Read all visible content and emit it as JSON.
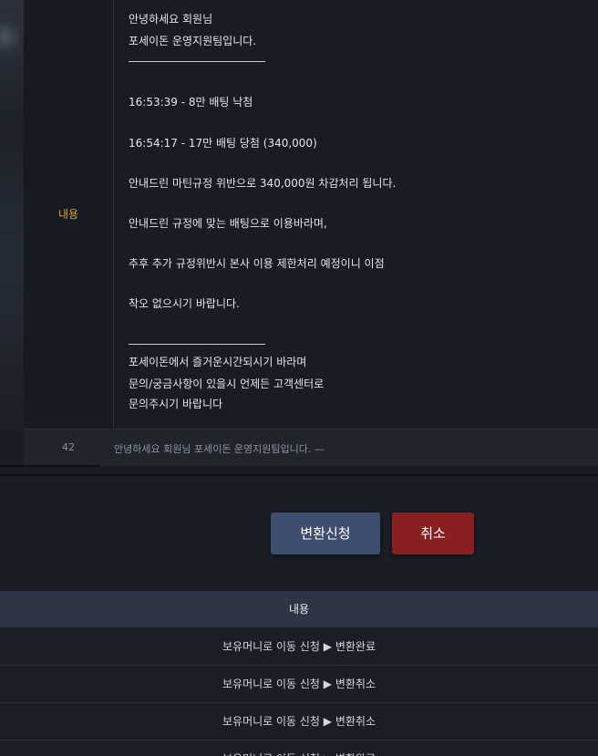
{
  "message": {
    "label": "내용",
    "lines": [
      "안녕하세요 회원님",
      "포세이돈 운영지원팀입니다.",
      "16:53:39 - 8만 배팅 낙첨",
      "16:54:17 - 17만 배팅 당첨 (340,000)",
      "안내드린 마틴규정 위반으로 340,000원 차감처리 됩니다.",
      "안내드린 규정에 맞는 배팅으로 이용바라며,",
      "추후 추가 규정위반시 본사 이용 제한처리 예정이니 이점",
      "착오 없으시기 바랍니다.",
      "포세이돈에서 즐거운시간되시기 바라며",
      "문의/궁금사항이 있을시 언제든 고객센터로",
      "문의주시기 바랍니다"
    ]
  },
  "row42": {
    "number": "42",
    "summary": "안녕하세요 회원님 포세이돈 운영지원팀입니다. —"
  },
  "buttons": {
    "apply_label": "변환신청",
    "cancel_label": "취소"
  },
  "table": {
    "header": "내용",
    "rows": [
      "보유머니로 이동 신청 ▶ 변환완료",
      "보유머니로 이동 신청 ▶ 변환취소",
      "보유머니로 이동 신청 ▶ 변환취소",
      "보유머니로 이동 신청 ▶ 변환완료"
    ]
  }
}
